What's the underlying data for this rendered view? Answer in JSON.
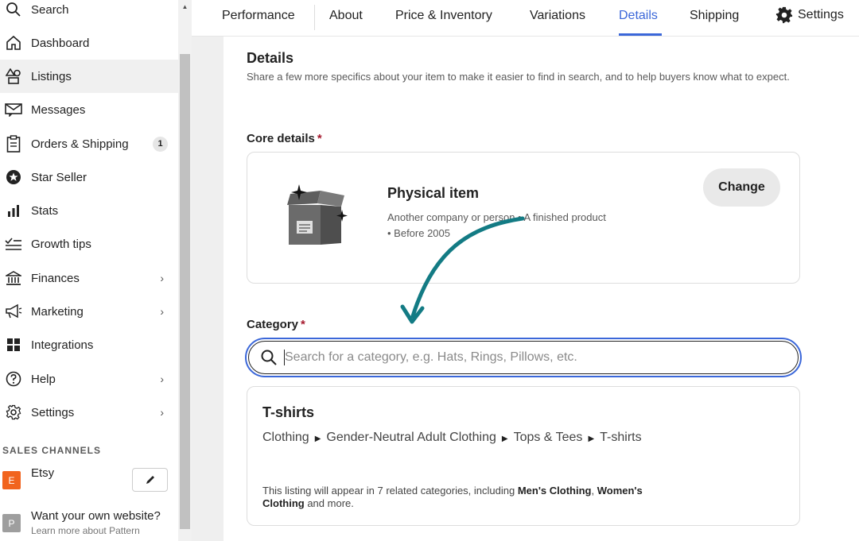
{
  "sidebar": {
    "items": [
      {
        "label": "Search",
        "icon": "search-icon"
      },
      {
        "label": "Dashboard",
        "icon": "home-icon"
      },
      {
        "label": "Listings",
        "icon": "shapes-icon",
        "active": true
      },
      {
        "label": "Messages",
        "icon": "mail-icon"
      },
      {
        "label": "Orders & Shipping",
        "icon": "clipboard-icon",
        "badge": "1"
      },
      {
        "label": "Star Seller",
        "icon": "star-badge-icon"
      },
      {
        "label": "Stats",
        "icon": "bar-chart-icon"
      },
      {
        "label": "Growth tips",
        "icon": "checklist-icon"
      },
      {
        "label": "Finances",
        "icon": "bank-icon",
        "chevron": "›"
      },
      {
        "label": "Marketing",
        "icon": "megaphone-icon",
        "chevron": "›"
      },
      {
        "label": "Integrations",
        "icon": "grid-icon"
      },
      {
        "label": "Help",
        "icon": "help-icon",
        "chevron": "›"
      },
      {
        "label": "Settings",
        "icon": "gear-icon",
        "chevron": "›"
      }
    ],
    "sales_channels_label": "SALES CHANNELS",
    "etsy": {
      "letter": "E",
      "label": "Etsy"
    },
    "pattern": {
      "letter": "P",
      "title": "Want your own website?",
      "subtitle": "Learn more about Pattern"
    }
  },
  "tabs": {
    "items": [
      "Performance",
      "About",
      "Price & Inventory",
      "Variations",
      "Details",
      "Shipping"
    ],
    "active": "Details",
    "settings_label": "Settings"
  },
  "details": {
    "title": "Details",
    "description": "Share a few more specifics about your item to make it easier to find in search, and to help buyers know what to expect."
  },
  "core": {
    "label": "Core details",
    "required_mark": "*",
    "item_title": "Physical item",
    "item_desc_line1": "Another company or person • A finished product",
    "item_desc_line2": "• Before 2005",
    "change_label": "Change"
  },
  "category": {
    "label": "Category",
    "required_mark": "*",
    "search_placeholder": "Search for a category, e.g. Hats, Rings, Pillows, etc.",
    "search_value": ""
  },
  "result": {
    "title": "T-shirts",
    "path": [
      "Clothing",
      "Gender-Neutral Adult Clothing",
      "Tops & Tees",
      "T-shirts"
    ],
    "note_prefix": "This listing will appear in 7 related categories, including ",
    "note_bold1": "Men's Clothing",
    "note_sep": ", ",
    "note_bold2": "Women's Clothing",
    "note_suffix": " and more."
  },
  "colors": {
    "accent_blue": "#3b67d9",
    "etsy_orange": "#f1641e",
    "required_red": "#a61a2e",
    "annotation_teal": "#137b84"
  }
}
